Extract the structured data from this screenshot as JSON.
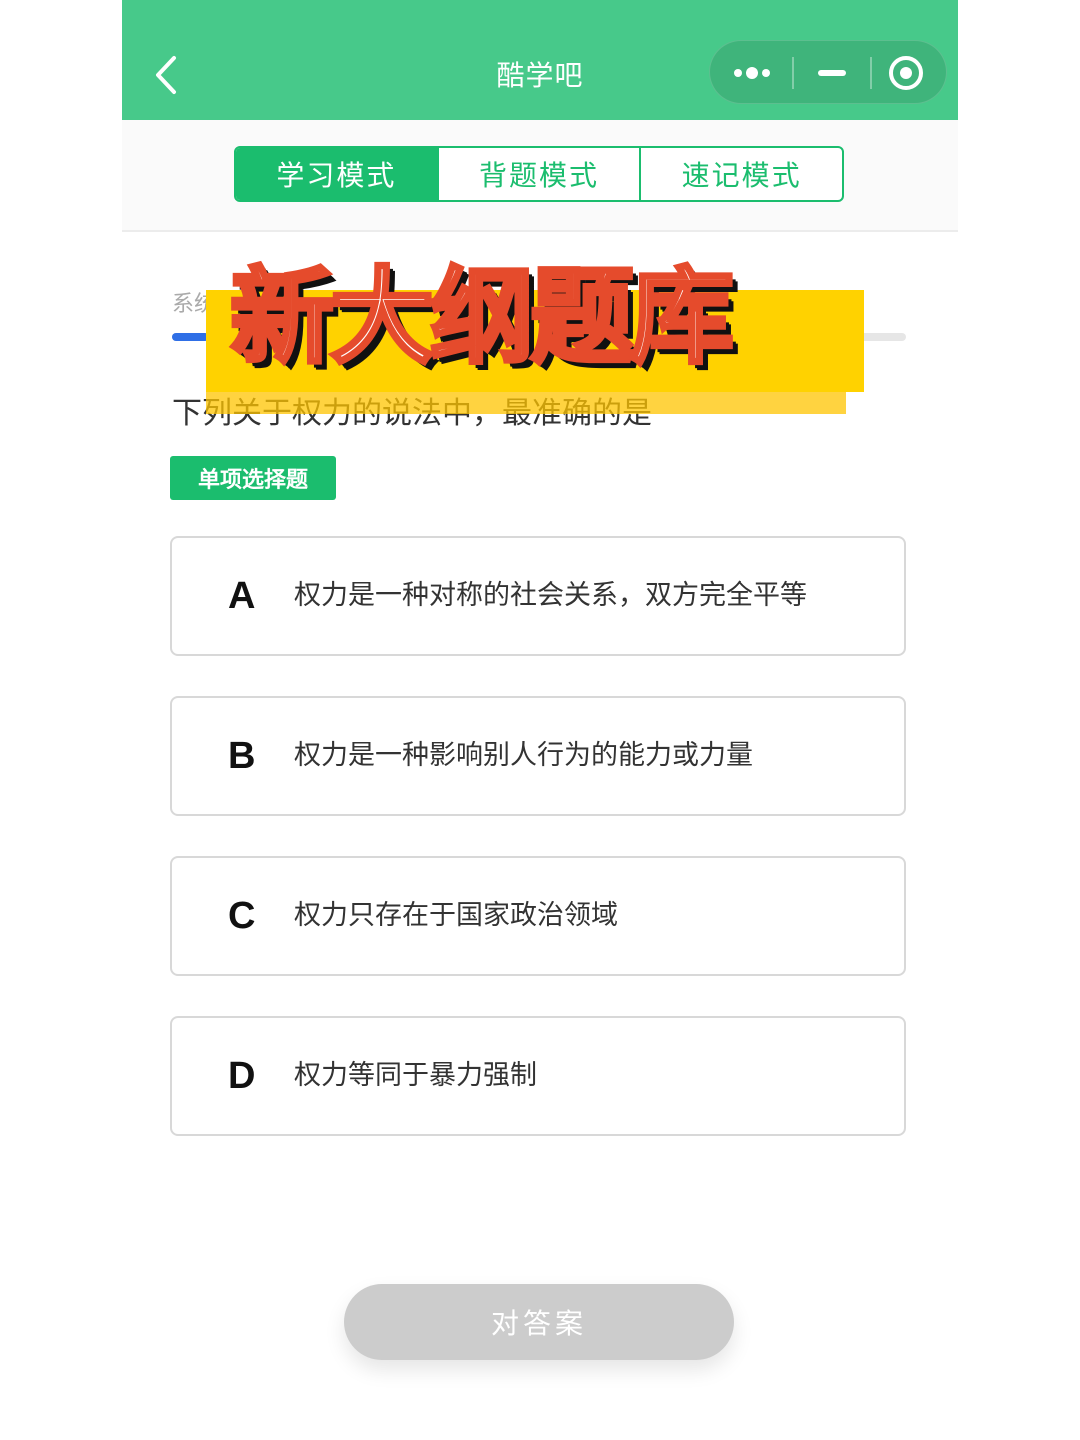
{
  "header": {
    "title": "酷学吧",
    "back_icon": "chevron-left-icon",
    "capsule": {
      "more_icon": "more-dots-icon",
      "minimize_icon": "minimize-icon",
      "close_icon": "target-circle-icon"
    }
  },
  "mode_tabs": [
    {
      "label": "学习模式",
      "active": true
    },
    {
      "label": "背题模式",
      "active": false
    },
    {
      "label": "速记模式",
      "active": false
    }
  ],
  "progress": {
    "label_visible": "系统",
    "fraction": 0.05
  },
  "question": {
    "text": "下列关于权力的说法中，最准确的是",
    "type_label": "单项选择题"
  },
  "banner": {
    "text": "新大纲题库"
  },
  "options": [
    {
      "letter": "A",
      "text": "权力是一种对称的社会关系，双方完全平等"
    },
    {
      "letter": "B",
      "text": "权力是一种影响别人行为的能力或力量"
    },
    {
      "letter": "C",
      "text": "权力只存在于国家政治领域"
    },
    {
      "letter": "D",
      "text": "权力等同于暴力强制"
    }
  ],
  "answer_button": {
    "label": "对答案"
  },
  "colors": {
    "header": "#47c98a",
    "accent": "#1bbd6e",
    "progress": "#2f6fe6",
    "banner": "#ffd200",
    "button_disabled": "#cccccc"
  }
}
